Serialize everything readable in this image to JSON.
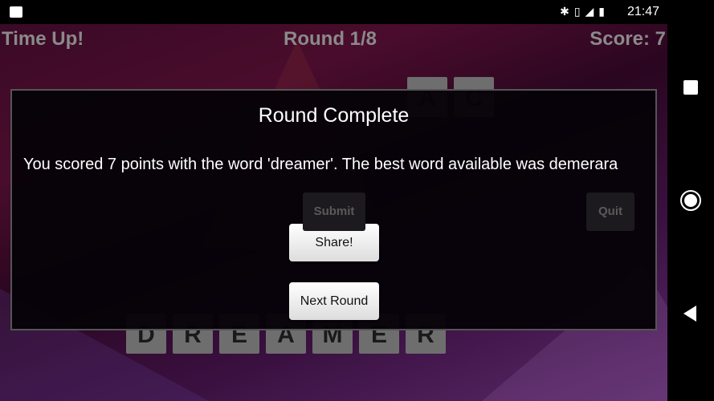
{
  "status_bar": {
    "time": "21:47",
    "icons": [
      "image-icon",
      "bluetooth-icon",
      "vibrate-icon",
      "signal-icon",
      "battery-icon"
    ]
  },
  "game": {
    "status": "Time Up!",
    "round": "Round 1/8",
    "score": "Score: 7",
    "top_tiles": [
      "A",
      "C"
    ],
    "word_tiles": [
      "D",
      "R",
      "E",
      "A",
      "M",
      "E",
      "R"
    ],
    "submit_label": "Submit",
    "quit_label": "Quit"
  },
  "dialog": {
    "title": "Round Complete",
    "message": "You scored 7 points with the word 'dreamer'. The best word available was demerara",
    "share_label": "Share!",
    "next_label": "Next Round"
  },
  "nav": {
    "icons": [
      "recents-icon",
      "home-icon",
      "back-icon"
    ]
  }
}
